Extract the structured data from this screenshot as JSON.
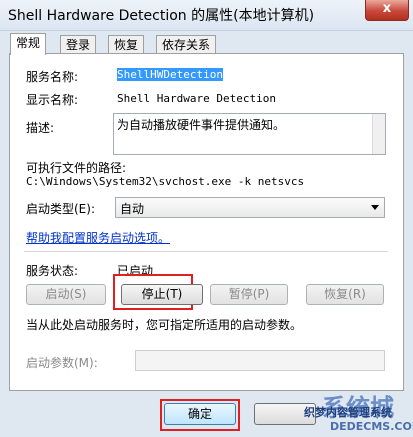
{
  "window": {
    "title": "Shell Hardware Detection 的属性(本地计算机)",
    "close_glyph": "x"
  },
  "tabs": [
    {
      "label": "常规"
    },
    {
      "label": "登录"
    },
    {
      "label": "恢复"
    },
    {
      "label": "依存关系"
    }
  ],
  "general": {
    "service_name_label": "服务名称:",
    "service_name_value": "ShellHWDetection",
    "display_name_label": "显示名称:",
    "display_name_value": "Shell Hardware Detection",
    "description_label": "描述:",
    "description_value": "为自动播放硬件事件提供通知。",
    "exe_path_label": "可执行文件的路径:",
    "exe_path_value": "C:\\Windows\\System32\\svchost.exe -k netsvcs",
    "startup_type_label": "启动类型(E):",
    "startup_type_value": "自动",
    "help_link": "帮助我配置服务启动选项。",
    "status_label": "服务状态:",
    "status_value": "已启动",
    "start_button": "启动(S)",
    "stop_button": "停止(T)",
    "pause_button": "暂停(P)",
    "resume_button": "恢复(R)",
    "hint_text": "当从此处启动服务时，您可指定所适用的启动参数。",
    "start_params_label": "启动参数(M):",
    "start_params_value": ""
  },
  "footer": {
    "ok_button": "确定"
  },
  "watermark": {
    "logo": "系统城",
    "text": "织梦内容管理系统",
    "url": "DEDECMS.COM"
  },
  "colors": {
    "selection": "#3399ff",
    "highlight_border": "#e02020",
    "link": "#0033cc"
  }
}
